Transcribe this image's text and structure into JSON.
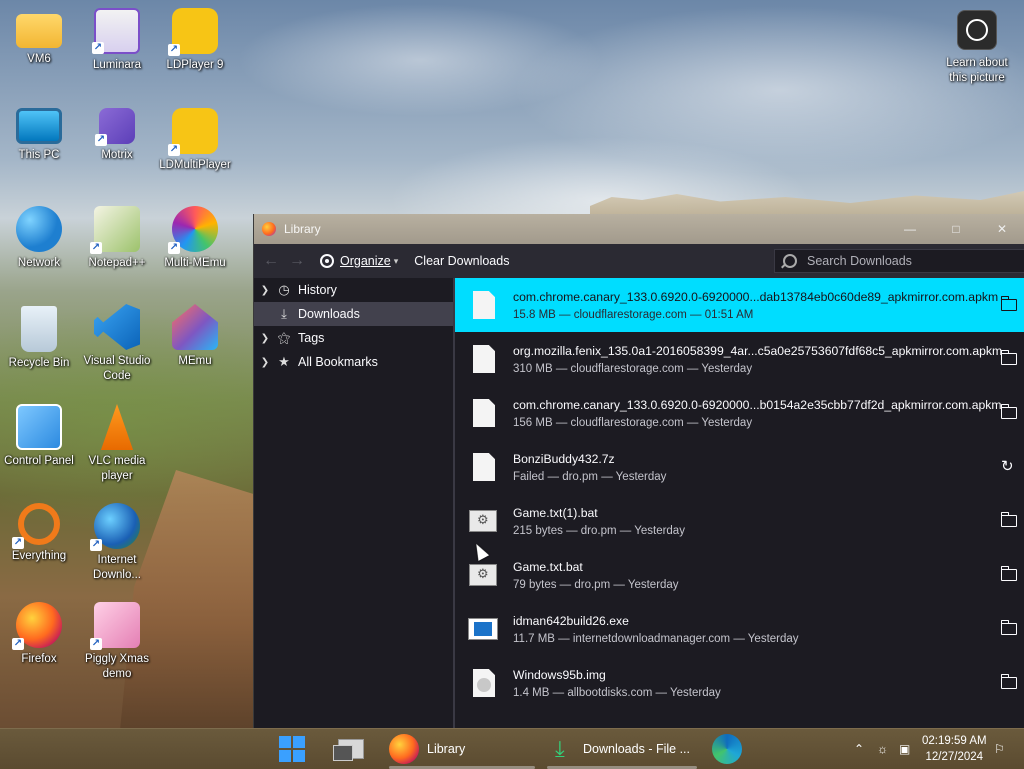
{
  "desktop": {
    "icons": [
      {
        "label": "VM6",
        "icon": "folder-icon"
      },
      {
        "label": "Luminara",
        "icon": "luminara-icon"
      },
      {
        "label": "LDPlayer 9",
        "icon": "ldplayer-icon"
      },
      {
        "label": "This PC",
        "icon": "monitor-icon"
      },
      {
        "label": "Motrix",
        "icon": "motrix-icon"
      },
      {
        "label": "LDMultiPlayer",
        "icon": "ldmultiplayer-icon"
      },
      {
        "label": "Network",
        "icon": "network-icon"
      },
      {
        "label": "Notepad++",
        "icon": "notepadplusplus-icon"
      },
      {
        "label": "Multi-MEmu",
        "icon": "multi-memu-icon"
      },
      {
        "label": "Recycle Bin",
        "icon": "recycle-bin-icon"
      },
      {
        "label": "Visual Studio Code",
        "icon": "vscode-icon"
      },
      {
        "label": "MEmu",
        "icon": "memu-icon"
      },
      {
        "label": "Control Panel",
        "icon": "control-panel-icon"
      },
      {
        "label": "VLC media player",
        "icon": "vlc-icon"
      },
      {
        "label": "Everything",
        "icon": "everything-icon"
      },
      {
        "label": "Internet Downlo...",
        "icon": "idm-icon"
      },
      {
        "label": "Firefox",
        "icon": "firefox-icon"
      },
      {
        "label": "Piggly Xmas demo",
        "icon": "piggly-icon"
      }
    ],
    "learn_label": "Learn about this picture"
  },
  "library": {
    "title": "Library",
    "toolbar": {
      "organize_label": "Organize",
      "clear_label": "Clear Downloads",
      "search_placeholder": "Search Downloads"
    },
    "sidebar": [
      {
        "label": "History",
        "icon": "clock-icon",
        "twisty": true
      },
      {
        "label": "Downloads",
        "icon": "download-icon",
        "twisty": false
      },
      {
        "label": "Tags",
        "icon": "tag-icon",
        "twisty": true
      },
      {
        "label": "All Bookmarks",
        "icon": "star-icon",
        "twisty": true
      }
    ],
    "downloads": [
      {
        "name": "com.chrome.canary_133.0.6920.0-6920000...dab13784eb0c60de89_apkmirror.com.apkm",
        "meta": "15.8 MB — cloudflarestorage.com — 01:51 AM",
        "file_icon": "file-icon",
        "action_icon": "folder-icon"
      },
      {
        "name": "org.mozilla.fenix_135.0a1-2016058399_4ar...c5a0e25753607fdf68c5_apkmirror.com.apkm",
        "meta": "310 MB — cloudflarestorage.com — Yesterday",
        "file_icon": "file-icon",
        "action_icon": "folder-icon"
      },
      {
        "name": "com.chrome.canary_133.0.6920.0-6920000...b0154a2e35cbb77df2d_apkmirror.com.apkm",
        "meta": "156 MB — cloudflarestorage.com — Yesterday",
        "file_icon": "file-icon",
        "action_icon": "folder-icon"
      },
      {
        "name": "BonziBuddy432.7z",
        "meta": "Failed — dro.pm — Yesterday",
        "file_icon": "file-icon",
        "action_icon": "retry-icon"
      },
      {
        "name": "Game.txt(1).bat",
        "meta": "215 bytes — dro.pm — Yesterday",
        "file_icon": "batch-file-icon",
        "action_icon": "folder-icon"
      },
      {
        "name": "Game.txt.bat",
        "meta": "79 bytes — dro.pm — Yesterday",
        "file_icon": "batch-file-icon",
        "action_icon": "folder-icon"
      },
      {
        "name": "idman642build26.exe",
        "meta": "11.7 MB — internetdownloadmanager.com — Yesterday",
        "file_icon": "exe-icon",
        "action_icon": "folder-icon"
      },
      {
        "name": "Windows95b.img",
        "meta": "1.4 MB — allbootdisks.com — Yesterday",
        "file_icon": "disk-image-icon",
        "action_icon": "folder-icon"
      }
    ]
  },
  "taskbar": {
    "firefox_label": "Library",
    "downloads_label": "Downloads - File ...",
    "time": "02:19:59 AM",
    "date": "12/27/2024"
  }
}
